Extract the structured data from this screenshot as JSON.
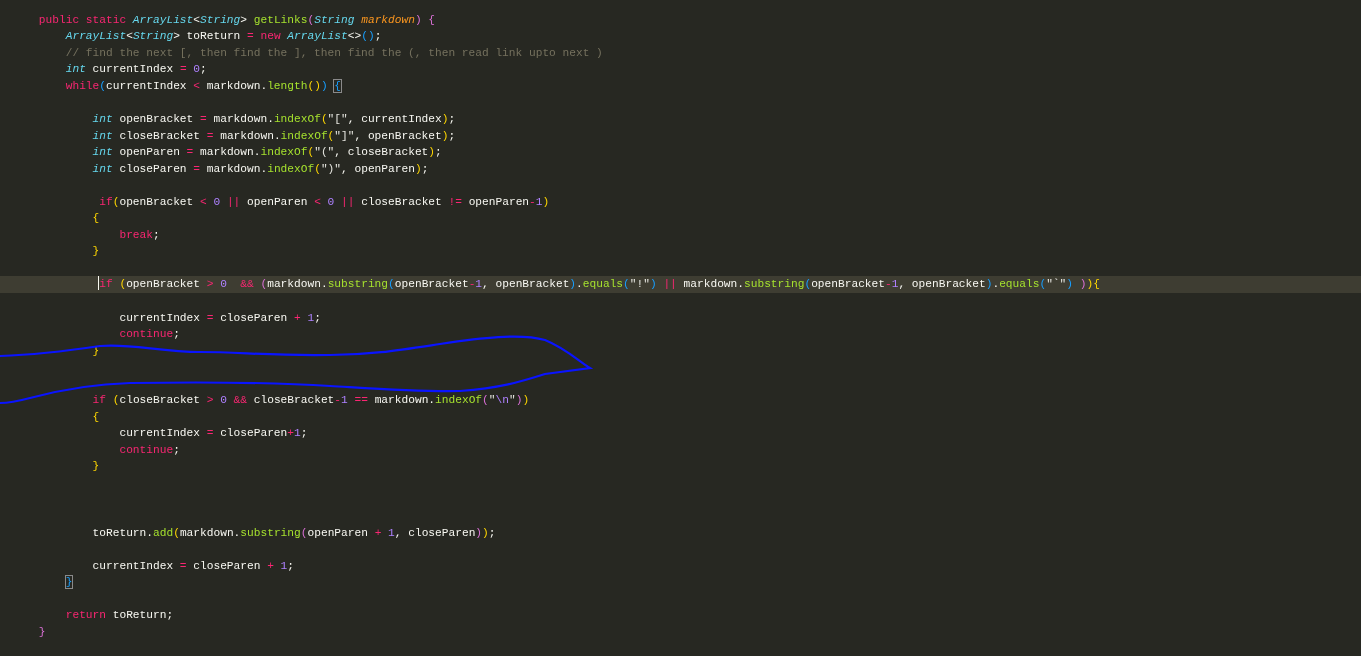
{
  "editor": {
    "lines": [
      {
        "current": false,
        "tokens": [
          {
            "text": "    public static ",
            "kind": "kw"
          },
          {
            "text": "ArrayList",
            "kind": "type"
          },
          {
            "text": "<",
            "kind": "pl"
          },
          {
            "text": "String",
            "kind": "type"
          },
          {
            "text": "> ",
            "kind": "pl"
          },
          {
            "text": "getLinks",
            "kind": "fn"
          },
          {
            "text": "(",
            "kind": "p2"
          },
          {
            "text": "String",
            "kind": "type"
          },
          {
            "text": " markdown",
            "kind": "param"
          },
          {
            "text": ")",
            "kind": "p2"
          },
          {
            "text": " {",
            "kind": "p2"
          }
        ]
      },
      {
        "current": false,
        "tokens": [
          {
            "text": "        ArrayList",
            "kind": "type"
          },
          {
            "text": "<",
            "kind": "pl"
          },
          {
            "text": "String",
            "kind": "type"
          },
          {
            "text": "> toReturn ",
            "kind": "pl"
          },
          {
            "text": "=",
            "kind": "op"
          },
          {
            "text": " new",
            "kind": "kw"
          },
          {
            "text": " ArrayList",
            "kind": "type"
          },
          {
            "text": "<>",
            "kind": "pl"
          },
          {
            "text": "()",
            "kind": "p3"
          },
          {
            "text": ";",
            "kind": "pl"
          }
        ]
      },
      {
        "current": false,
        "tokens": [
          {
            "text": "        // find the next [, then find the ], then find the (, then read link upto next )",
            "kind": "comment"
          }
        ]
      },
      {
        "current": false,
        "tokens": [
          {
            "text": "        int",
            "kind": "type"
          },
          {
            "text": " currentIndex ",
            "kind": "pl"
          },
          {
            "text": "=",
            "kind": "op"
          },
          {
            "text": " 0",
            "kind": "num"
          },
          {
            "text": ";",
            "kind": "pl"
          }
        ]
      },
      {
        "current": false,
        "tokens": [
          {
            "text": "        while",
            "kind": "kw"
          },
          {
            "text": "(",
            "kind": "p3"
          },
          {
            "text": "currentIndex ",
            "kind": "pl"
          },
          {
            "text": "<",
            "kind": "op"
          },
          {
            "text": " markdown.",
            "kind": "pl"
          },
          {
            "text": "length",
            "kind": "fn"
          },
          {
            "text": "()",
            "kind": "p1"
          },
          {
            "text": ") ",
            "kind": "p3"
          },
          {
            "text": "{",
            "kind": "match"
          }
        ]
      },
      {
        "current": false
      },
      {
        "current": false,
        "tokens": [
          {
            "text": "            int",
            "kind": "type"
          },
          {
            "text": " openBracket ",
            "kind": "pl"
          },
          {
            "text": "=",
            "kind": "op"
          },
          {
            "text": " markdown.",
            "kind": "pl"
          },
          {
            "text": "indexOf",
            "kind": "fn"
          },
          {
            "text": "(",
            "kind": "p1"
          },
          {
            "text": "\"[\"",
            "kind": "str"
          },
          {
            "text": ", currentIndex",
            "kind": "pl"
          },
          {
            "text": ")",
            "kind": "p1"
          },
          {
            "text": ";",
            "kind": "pl"
          }
        ]
      },
      {
        "current": false,
        "tokens": [
          {
            "text": "            int",
            "kind": "type"
          },
          {
            "text": " closeBracket ",
            "kind": "pl"
          },
          {
            "text": "=",
            "kind": "op"
          },
          {
            "text": " markdown.",
            "kind": "pl"
          },
          {
            "text": "indexOf",
            "kind": "fn"
          },
          {
            "text": "(",
            "kind": "p1"
          },
          {
            "text": "\"]\"",
            "kind": "str"
          },
          {
            "text": ", openBracket",
            "kind": "pl"
          },
          {
            "text": ")",
            "kind": "p1"
          },
          {
            "text": ";",
            "kind": "pl"
          }
        ]
      },
      {
        "current": false,
        "tokens": [
          {
            "text": "            int",
            "kind": "type"
          },
          {
            "text": " openParen ",
            "kind": "pl"
          },
          {
            "text": "=",
            "kind": "op"
          },
          {
            "text": " markdown.",
            "kind": "pl"
          },
          {
            "text": "indexOf",
            "kind": "fn"
          },
          {
            "text": "(",
            "kind": "p1"
          },
          {
            "text": "\"(\"",
            "kind": "str"
          },
          {
            "text": ", closeBracket",
            "kind": "pl"
          },
          {
            "text": ")",
            "kind": "p1"
          },
          {
            "text": ";",
            "kind": "pl"
          }
        ]
      },
      {
        "current": false,
        "tokens": [
          {
            "text": "            int",
            "kind": "type"
          },
          {
            "text": " closeParen ",
            "kind": "pl"
          },
          {
            "text": "=",
            "kind": "op"
          },
          {
            "text": " markdown.",
            "kind": "pl"
          },
          {
            "text": "indexOf",
            "kind": "fn"
          },
          {
            "text": "(",
            "kind": "p1"
          },
          {
            "text": "\")\"",
            "kind": "str"
          },
          {
            "text": ", openParen",
            "kind": "pl"
          },
          {
            "text": ")",
            "kind": "p1"
          },
          {
            "text": ";",
            "kind": "pl"
          }
        ]
      },
      {
        "current": false
      },
      {
        "current": false,
        "tokens": [
          {
            "text": "             if",
            "kind": "kw"
          },
          {
            "text": "(",
            "kind": "p1"
          },
          {
            "text": "openBracket ",
            "kind": "pl"
          },
          {
            "text": "<",
            "kind": "op"
          },
          {
            "text": " 0 ",
            "kind": "num"
          },
          {
            "text": "||",
            "kind": "op"
          },
          {
            "text": " openParen ",
            "kind": "pl"
          },
          {
            "text": "<",
            "kind": "op"
          },
          {
            "text": " 0 ",
            "kind": "num"
          },
          {
            "text": "||",
            "kind": "op"
          },
          {
            "text": " closeBracket ",
            "kind": "pl"
          },
          {
            "text": "!=",
            "kind": "op"
          },
          {
            "text": " openParen",
            "kind": "pl"
          },
          {
            "text": "-",
            "kind": "op"
          },
          {
            "text": "1",
            "kind": "num"
          },
          {
            "text": ")",
            "kind": "p1"
          }
        ]
      },
      {
        "current": false,
        "tokens": [
          {
            "text": "            {",
            "kind": "p1"
          }
        ]
      },
      {
        "current": false,
        "tokens": [
          {
            "text": "                break",
            "kind": "kw"
          },
          {
            "text": ";",
            "kind": "pl"
          }
        ]
      },
      {
        "current": false,
        "tokens": [
          {
            "text": "            }",
            "kind": "p1"
          }
        ]
      },
      {
        "current": false
      },
      {
        "current": true,
        "tokens": [
          {
            "text": "             if",
            "kind": "kw"
          },
          {
            "text": " (",
            "kind": "p1"
          },
          {
            "text": "openBracket ",
            "kind": "pl"
          },
          {
            "text": ">",
            "kind": "op"
          },
          {
            "text": " 0  ",
            "kind": "num"
          },
          {
            "text": "&&",
            "kind": "op"
          },
          {
            "text": " (",
            "kind": "p2"
          },
          {
            "text": "markdown.",
            "kind": "pl"
          },
          {
            "text": "substring",
            "kind": "fn"
          },
          {
            "text": "(",
            "kind": "p3"
          },
          {
            "text": "openBracket",
            "kind": "pl"
          },
          {
            "text": "-",
            "kind": "op"
          },
          {
            "text": "1",
            "kind": "num"
          },
          {
            "text": ", openBracket",
            "kind": "pl"
          },
          {
            "text": ")",
            "kind": "p3"
          },
          {
            "text": ".",
            "kind": "pl"
          },
          {
            "text": "equals",
            "kind": "fn"
          },
          {
            "text": "(",
            "kind": "p3"
          },
          {
            "text": "\"!\"",
            "kind": "str"
          },
          {
            "text": ") ",
            "kind": "p3"
          },
          {
            "text": "||",
            "kind": "op"
          },
          {
            "text": " markdown.",
            "kind": "pl"
          },
          {
            "text": "substring",
            "kind": "fn"
          },
          {
            "text": "(",
            "kind": "p3"
          },
          {
            "text": "openBracket",
            "kind": "pl"
          },
          {
            "text": "-",
            "kind": "op"
          },
          {
            "text": "1",
            "kind": "num"
          },
          {
            "text": ", openBracket",
            "kind": "pl"
          },
          {
            "text": ")",
            "kind": "p3"
          },
          {
            "text": ".",
            "kind": "pl"
          },
          {
            "text": "equals",
            "kind": "fn"
          },
          {
            "text": "(",
            "kind": "p3"
          },
          {
            "text": "\"`\"",
            "kind": "str"
          },
          {
            "text": ") ",
            "kind": "p3"
          },
          {
            "text": ")",
            "kind": "p2"
          },
          {
            "text": ")",
            "kind": "p1"
          },
          {
            "text": "{",
            "kind": "p1"
          }
        ]
      },
      {
        "current": false
      },
      {
        "current": false,
        "tokens": [
          {
            "text": "                currentIndex ",
            "kind": "pl"
          },
          {
            "text": "=",
            "kind": "op"
          },
          {
            "text": " closeParen ",
            "kind": "pl"
          },
          {
            "text": "+",
            "kind": "op"
          },
          {
            "text": " 1",
            "kind": "num"
          },
          {
            "text": ";",
            "kind": "pl"
          }
        ]
      },
      {
        "current": false,
        "tokens": [
          {
            "text": "                continue",
            "kind": "kw"
          },
          {
            "text": ";",
            "kind": "pl"
          }
        ]
      },
      {
        "current": false,
        "tokens": [
          {
            "text": "            }",
            "kind": "p1"
          }
        ]
      },
      {
        "current": false
      },
      {
        "current": false
      },
      {
        "current": false,
        "tokens": [
          {
            "text": "            if",
            "kind": "kw"
          },
          {
            "text": " (",
            "kind": "p1"
          },
          {
            "text": "closeBracket ",
            "kind": "pl"
          },
          {
            "text": ">",
            "kind": "op"
          },
          {
            "text": " 0 ",
            "kind": "num"
          },
          {
            "text": "&&",
            "kind": "op"
          },
          {
            "text": " closeBracket",
            "kind": "pl"
          },
          {
            "text": "-",
            "kind": "op"
          },
          {
            "text": "1 ",
            "kind": "num"
          },
          {
            "text": "==",
            "kind": "op"
          },
          {
            "text": " markdown.",
            "kind": "pl"
          },
          {
            "text": "indexOf",
            "kind": "fn"
          },
          {
            "text": "(",
            "kind": "p2"
          },
          {
            "text": "\"",
            "kind": "str"
          },
          {
            "text": "\\n",
            "kind": "esc"
          },
          {
            "text": "\"",
            "kind": "str"
          },
          {
            "text": ")",
            "kind": "p2"
          },
          {
            "text": ")",
            "kind": "p1"
          }
        ]
      },
      {
        "current": false,
        "tokens": [
          {
            "text": "            {",
            "kind": "p1"
          }
        ]
      },
      {
        "current": false,
        "tokens": [
          {
            "text": "                currentIndex ",
            "kind": "pl"
          },
          {
            "text": "=",
            "kind": "op"
          },
          {
            "text": " closeParen",
            "kind": "pl"
          },
          {
            "text": "+",
            "kind": "op"
          },
          {
            "text": "1",
            "kind": "num"
          },
          {
            "text": ";",
            "kind": "pl"
          }
        ]
      },
      {
        "current": false,
        "tokens": [
          {
            "text": "                continue",
            "kind": "kw"
          },
          {
            "text": ";",
            "kind": "pl"
          }
        ]
      },
      {
        "current": false,
        "tokens": [
          {
            "text": "            }",
            "kind": "p1"
          }
        ]
      },
      {
        "current": false
      },
      {
        "current": false
      },
      {
        "current": false
      },
      {
        "current": false,
        "tokens": [
          {
            "text": "            toReturn.",
            "kind": "pl"
          },
          {
            "text": "add",
            "kind": "fn"
          },
          {
            "text": "(",
            "kind": "p1"
          },
          {
            "text": "markdown.",
            "kind": "pl"
          },
          {
            "text": "substring",
            "kind": "fn"
          },
          {
            "text": "(",
            "kind": "p2"
          },
          {
            "text": "openParen ",
            "kind": "pl"
          },
          {
            "text": "+",
            "kind": "op"
          },
          {
            "text": " 1",
            "kind": "num"
          },
          {
            "text": ", closeParen",
            "kind": "pl"
          },
          {
            "text": ")",
            "kind": "p2"
          },
          {
            "text": ")",
            "kind": "p1"
          },
          {
            "text": ";",
            "kind": "pl"
          }
        ]
      },
      {
        "current": false
      },
      {
        "current": false,
        "tokens": [
          {
            "text": "            currentIndex ",
            "kind": "pl"
          },
          {
            "text": "=",
            "kind": "op"
          },
          {
            "text": " closeParen ",
            "kind": "pl"
          },
          {
            "text": "+",
            "kind": "op"
          },
          {
            "text": " 1",
            "kind": "num"
          },
          {
            "text": ";",
            "kind": "pl"
          }
        ]
      },
      {
        "current": false,
        "tokens": [
          {
            "text": "        }",
            "kind": "match"
          }
        ]
      },
      {
        "current": false
      },
      {
        "current": false,
        "tokens": [
          {
            "text": "        return",
            "kind": "kw"
          },
          {
            "text": " toReturn;",
            "kind": "pl"
          }
        ]
      },
      {
        "current": false,
        "tokens": [
          {
            "text": "    }",
            "kind": "p2"
          }
        ]
      }
    ]
  }
}
